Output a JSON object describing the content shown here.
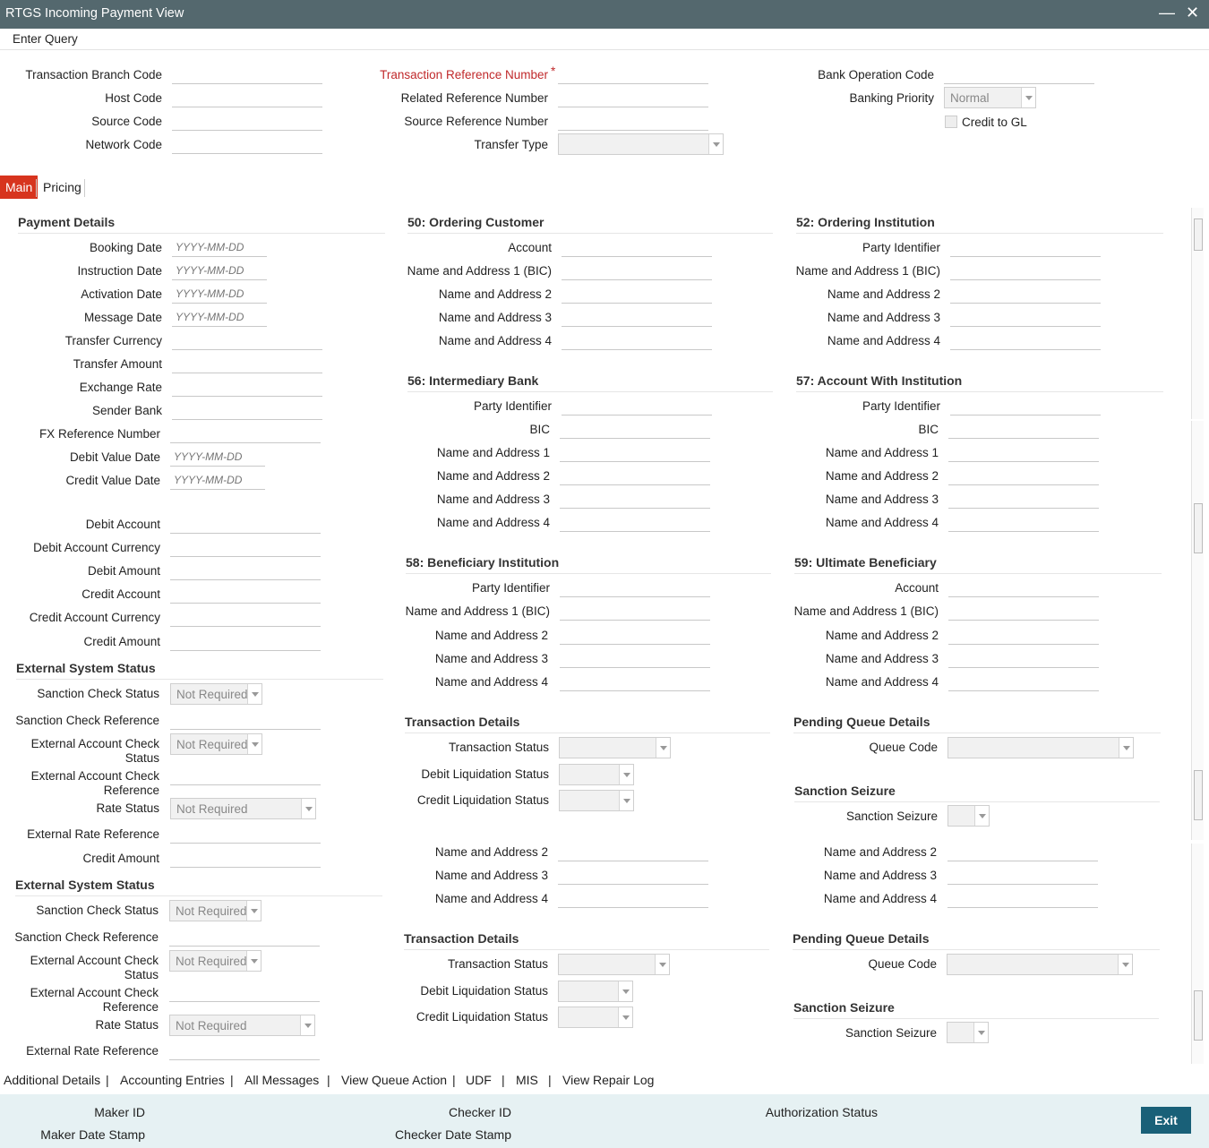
{
  "window": {
    "title": "RTGS Incoming Payment View",
    "minimize": "—",
    "close": "✕"
  },
  "menu": {
    "enter_query": "Enter Query"
  },
  "header": {
    "transaction_branch_code": "Transaction Branch Code",
    "host_code": "Host Code",
    "source_code": "Source Code",
    "network_code": "Network Code",
    "transaction_reference_number": "Transaction Reference Number",
    "required_mark": "*",
    "related_reference_number": "Related Reference Number",
    "source_reference_number": "Source Reference Number",
    "transfer_type": "Transfer Type",
    "bank_operation_code": "Bank Operation Code",
    "banking_priority": "Banking Priority",
    "banking_priority_value": "Normal",
    "credit_to_gl": "Credit to GL"
  },
  "tabs": {
    "main": "Main",
    "pricing": "Pricing"
  },
  "date_placeholder": "YYYY-MM-DD",
  "payment_details": {
    "title": "Payment Details",
    "booking_date": "Booking Date",
    "instruction_date": "Instruction Date",
    "activation_date": "Activation Date",
    "message_date": "Message Date",
    "transfer_currency": "Transfer Currency",
    "transfer_amount": "Transfer Amount",
    "exchange_rate": "Exchange Rate",
    "sender_bank": "Sender Bank",
    "fx_reference_number": "FX Reference Number",
    "debit_value_date": "Debit Value Date",
    "credit_value_date": "Credit Value Date",
    "debit_account": "Debit Account",
    "debit_account_currency": "Debit Account Currency",
    "debit_amount": "Debit Amount",
    "credit_account": "Credit Account",
    "credit_account_currency": "Credit Account Currency",
    "credit_amount": "Credit Amount"
  },
  "ordering_customer": {
    "title": "50: Ordering Customer",
    "account": "Account",
    "na1": "Name and Address 1 (BIC)",
    "na2": "Name and Address 2",
    "na3": "Name and Address 3",
    "na4": "Name and Address 4"
  },
  "ordering_institution": {
    "title": "52: Ordering Institution",
    "party_identifier": "Party Identifier",
    "na1": "Name and Address 1 (BIC)",
    "na2": "Name and Address 2",
    "na3": "Name and Address 3",
    "na4": "Name and Address 4"
  },
  "intermediary_bank": {
    "title": "56: Intermediary Bank",
    "party_identifier": "Party Identifier",
    "bic": "BIC",
    "na1": "Name and Address 1",
    "na2": "Name and Address 2",
    "na3": "Name and Address 3",
    "na4": "Name and Address 4"
  },
  "account_with_institution": {
    "title": "57: Account With Institution",
    "party_identifier": "Party Identifier",
    "bic": "BIC",
    "na1": "Name and Address 1",
    "na2": "Name and Address 2",
    "na3": "Name and Address 3",
    "na4": "Name and Address 4"
  },
  "beneficiary_institution": {
    "title": "58: Beneficiary Institution",
    "party_identifier": "Party Identifier",
    "na1": "Name and Address 1 (BIC)",
    "na2": "Name and Address 2",
    "na3": "Name and Address 3",
    "na4": "Name and Address 4"
  },
  "ultimate_beneficiary": {
    "title": "59: Ultimate Beneficiary",
    "account": "Account",
    "na1": "Name and Address 1 (BIC)",
    "na2": "Name and Address 2",
    "na3": "Name and Address 3",
    "na4": "Name and Address 4"
  },
  "external_system_status": {
    "title": "External System Status",
    "sanction_check_status": "Sanction Check Status",
    "sanction_check_reference": "Sanction Check Reference",
    "external_account_check_status": "External Account Check Status",
    "external_account_check_reference": "External Account Check Reference",
    "rate_status": "Rate Status",
    "external_rate_reference": "External Rate Reference",
    "credit_amount": "Credit Amount",
    "not_required": "Not Required"
  },
  "transaction_details": {
    "title": "Transaction Details",
    "transaction_status": "Transaction Status",
    "debit_liquidation_status": "Debit Liquidation Status",
    "credit_liquidation_status": "Credit Liquidation Status"
  },
  "pending_queue": {
    "title": "Pending Queue Details",
    "queue_code": "Queue Code"
  },
  "sanction_seizure": {
    "title": "Sanction Seizure",
    "label": "Sanction Seizure"
  },
  "na_labels": {
    "na2": "Name and Address 2",
    "na3": "Name and Address 3",
    "na4": "Name and Address 4"
  },
  "bottom_links": {
    "additional_details": "Additional Details",
    "accounting_entries": "Accounting Entries",
    "all_messages": "All Messages",
    "view_queue_action": "View Queue Action",
    "udf": "UDF",
    "mis": "MIS",
    "view_repair_log": "View Repair Log",
    "separator": "|"
  },
  "footer": {
    "maker_id": "Maker ID",
    "maker_date_stamp": "Maker Date Stamp",
    "checker_id": "Checker ID",
    "checker_date_stamp": "Checker Date Stamp",
    "authorization_status": "Authorization Status",
    "exit": "Exit"
  },
  "colors": {
    "titlebar": "#54686e",
    "active_tab": "#d7341e",
    "exit_button": "#196078",
    "footer_bg": "#e6f1f3",
    "required": "#c0292b"
  }
}
